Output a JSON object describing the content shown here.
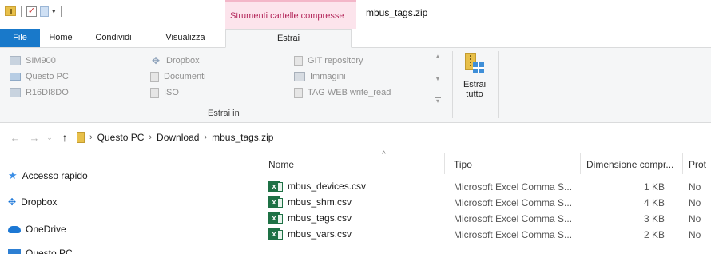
{
  "title_bar": {
    "contextual_tab": "Strumenti cartelle compresse",
    "window_title": "mbus_tags.zip"
  },
  "ribbon_tabs": [
    "File",
    "Home",
    "Condividi",
    "Visualizza",
    "Estrai"
  ],
  "ribbon": {
    "destinations": [
      {
        "label": "SIM900",
        "icon": "drive-icon"
      },
      {
        "label": "Dropbox",
        "icon": "dropbox-icon"
      },
      {
        "label": "GIT repository",
        "icon": "document-icon"
      },
      {
        "label": "Questo PC",
        "icon": "pc-icon"
      },
      {
        "label": "Documenti",
        "icon": "document-icon"
      },
      {
        "label": "Immagini",
        "icon": "image-icon"
      },
      {
        "label": "R16DI8DO",
        "icon": "drive-icon"
      },
      {
        "label": "ISO",
        "icon": "document-icon"
      },
      {
        "label": "TAG WEB write_read",
        "icon": "document-icon"
      }
    ],
    "group_label": "Estrai in",
    "extract_all": "Estrai tutto"
  },
  "address_bar": {
    "breadcrumbs": [
      "Questo PC",
      "Download",
      "mbus_tags.zip"
    ]
  },
  "nav_pane": {
    "items": [
      "Accesso rapido",
      "Dropbox",
      "OneDrive",
      "Questo PC"
    ]
  },
  "file_list": {
    "columns": [
      "Nome",
      "Tipo",
      "Dimensione compr...",
      "Prot"
    ],
    "rows": [
      {
        "name": "mbus_devices.csv",
        "type": "Microsoft Excel Comma S...",
        "size": "1 KB",
        "prot": "No"
      },
      {
        "name": "mbus_shm.csv",
        "type": "Microsoft Excel Comma S...",
        "size": "4 KB",
        "prot": "No"
      },
      {
        "name": "mbus_tags.csv",
        "type": "Microsoft Excel Comma S...",
        "size": "3 KB",
        "prot": "No"
      },
      {
        "name": "mbus_vars.csv",
        "type": "Microsoft Excel Comma S...",
        "size": "2 KB",
        "prot": "No"
      }
    ]
  },
  "colors": {
    "file_tab": "#1979ca",
    "contextual_tab_bg": "#fce4ec",
    "contextual_tab_text": "#b3265a",
    "ribbon_bg": "#f5f6f7"
  }
}
